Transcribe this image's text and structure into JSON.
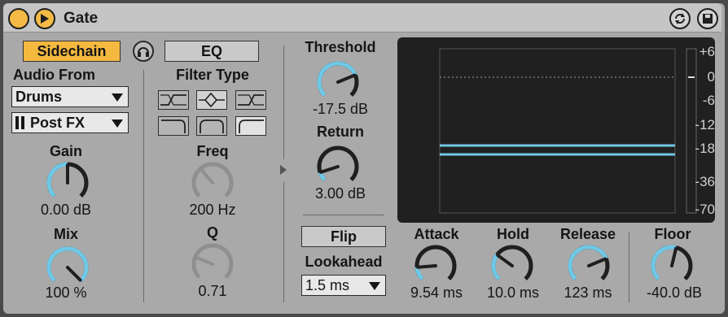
{
  "title": "Gate",
  "sidechain": {
    "label": "Sidechain",
    "color": "#f5b940"
  },
  "eq_label": "EQ",
  "audio_from": {
    "label": "Audio From",
    "source": "Drums",
    "tap": "Post FX"
  },
  "filter_type": {
    "label": "Filter Type"
  },
  "knobs": {
    "gain": {
      "label": "Gain",
      "value": "0.00 dB",
      "level": 0.5
    },
    "mix": {
      "label": "Mix",
      "value": "100 %",
      "level": 1.0
    },
    "freq": {
      "label": "Freq",
      "value": "200 Hz",
      "level": 0.35
    },
    "q": {
      "label": "Q",
      "value": "0.71",
      "level": 0.25
    },
    "threshold": {
      "label": "Threshold",
      "value": "-17.5 dB",
      "level": 0.75
    },
    "return": {
      "label": "Return",
      "value": "3.00 dB",
      "level": 0.1
    },
    "attack": {
      "label": "Attack",
      "value": "9.54 ms",
      "level": 0.15
    },
    "hold": {
      "label": "Hold",
      "value": "10.0 ms",
      "level": 0.3
    },
    "release": {
      "label": "Release",
      "value": "123 ms",
      "level": 0.75
    },
    "floor": {
      "label": "Floor",
      "value": "-40.0 dB",
      "level": 0.55
    }
  },
  "flip_label": "Flip",
  "lookahead": {
    "label": "Lookahead",
    "value": "1.5 ms"
  },
  "display": {
    "db_labels": [
      "+6",
      "0",
      "-6",
      "-12",
      "-18",
      "-36",
      "-70"
    ],
    "threshold_line_color": "#6fc8e6"
  }
}
